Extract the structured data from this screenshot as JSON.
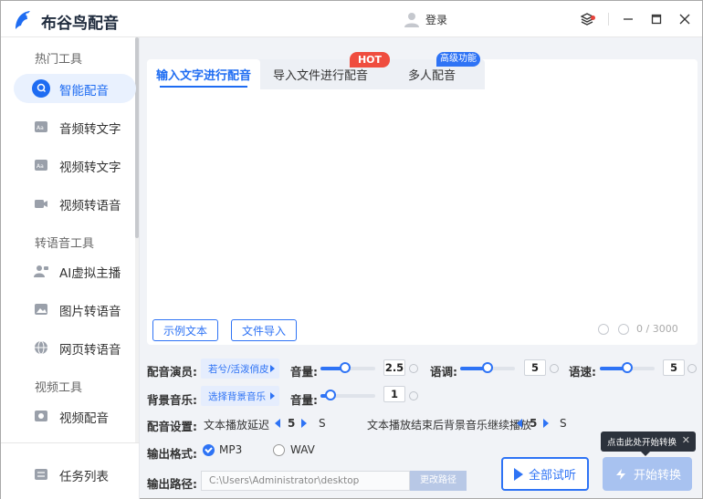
{
  "app": {
    "title": "布谷鸟配音",
    "login_label": "登录"
  },
  "sidebar": {
    "sections": [
      {
        "label": "热门工具",
        "items": [
          {
            "label": "智能配音",
            "icon": "mic-bubble-icon",
            "active": true
          },
          {
            "label": "音频转文字",
            "icon": "audio-text-icon"
          },
          {
            "label": "视频转文字",
            "icon": "video-text-icon"
          },
          {
            "label": "视频转语音",
            "icon": "video-camera-icon"
          }
        ]
      },
      {
        "label": "转语音工具",
        "items": [
          {
            "label": "AI虚拟主播",
            "icon": "avatar-host-icon"
          },
          {
            "label": "图片转语音",
            "icon": "image-icon"
          },
          {
            "label": "网页转语音",
            "icon": "globe-icon"
          }
        ]
      },
      {
        "label": "视频工具",
        "items": [
          {
            "label": "视频配音",
            "icon": "video-dub-icon"
          }
        ]
      }
    ],
    "task_list": {
      "label": "任务列表",
      "icon": "list-icon"
    }
  },
  "tabs": [
    {
      "label": "输入文字进行配音",
      "active": true
    },
    {
      "label": "导入文件进行配音",
      "badge": "HOT"
    },
    {
      "label": "多人配音",
      "badge": "高级功能"
    }
  ],
  "editor": {
    "text": "",
    "example_button": "示例文本",
    "import_button": "文件导入",
    "char_count": "0 / 3000"
  },
  "voice": {
    "label": "配音演员:",
    "selected": "若兮/活泼俏皮",
    "volume_label": "音量:",
    "volume": 2.5,
    "volume_fraction": 0.45,
    "pitch_label": "语调:",
    "pitch": 5,
    "pitch_fraction": 0.5,
    "speed_label": "语速:",
    "speed": 5,
    "speed_fraction": 0.5
  },
  "bgm": {
    "label": "背景音乐:",
    "selected": "选择背景音乐",
    "volume_label": "音量:",
    "volume": 1,
    "volume_fraction": 0.18
  },
  "dub_settings": {
    "label": "配音设置:",
    "delay_label": "文本播放延迟",
    "delay_value": 5,
    "delay_unit": "S",
    "continue_label": "文本播放结束后背景音乐继续播放",
    "continue_value": 5,
    "continue_unit": "S"
  },
  "output_format": {
    "label": "输出格式:",
    "options": [
      {
        "label": "MP3",
        "selected": true
      },
      {
        "label": "WAV",
        "selected": false
      }
    ]
  },
  "output_path": {
    "label": "输出路径:",
    "value": "C:\\Users\\Administrator\\desktop",
    "change_button": "更改路径"
  },
  "actions": {
    "listen_all": "全部试听",
    "start_convert": "开始转换",
    "tooltip": "点击此处开始转换",
    "tooltip_close": "✕"
  },
  "colors": {
    "accent": "#2e73f5",
    "hot_badge": "#ef4d3f",
    "start_disabled": "#a8c2f0"
  }
}
